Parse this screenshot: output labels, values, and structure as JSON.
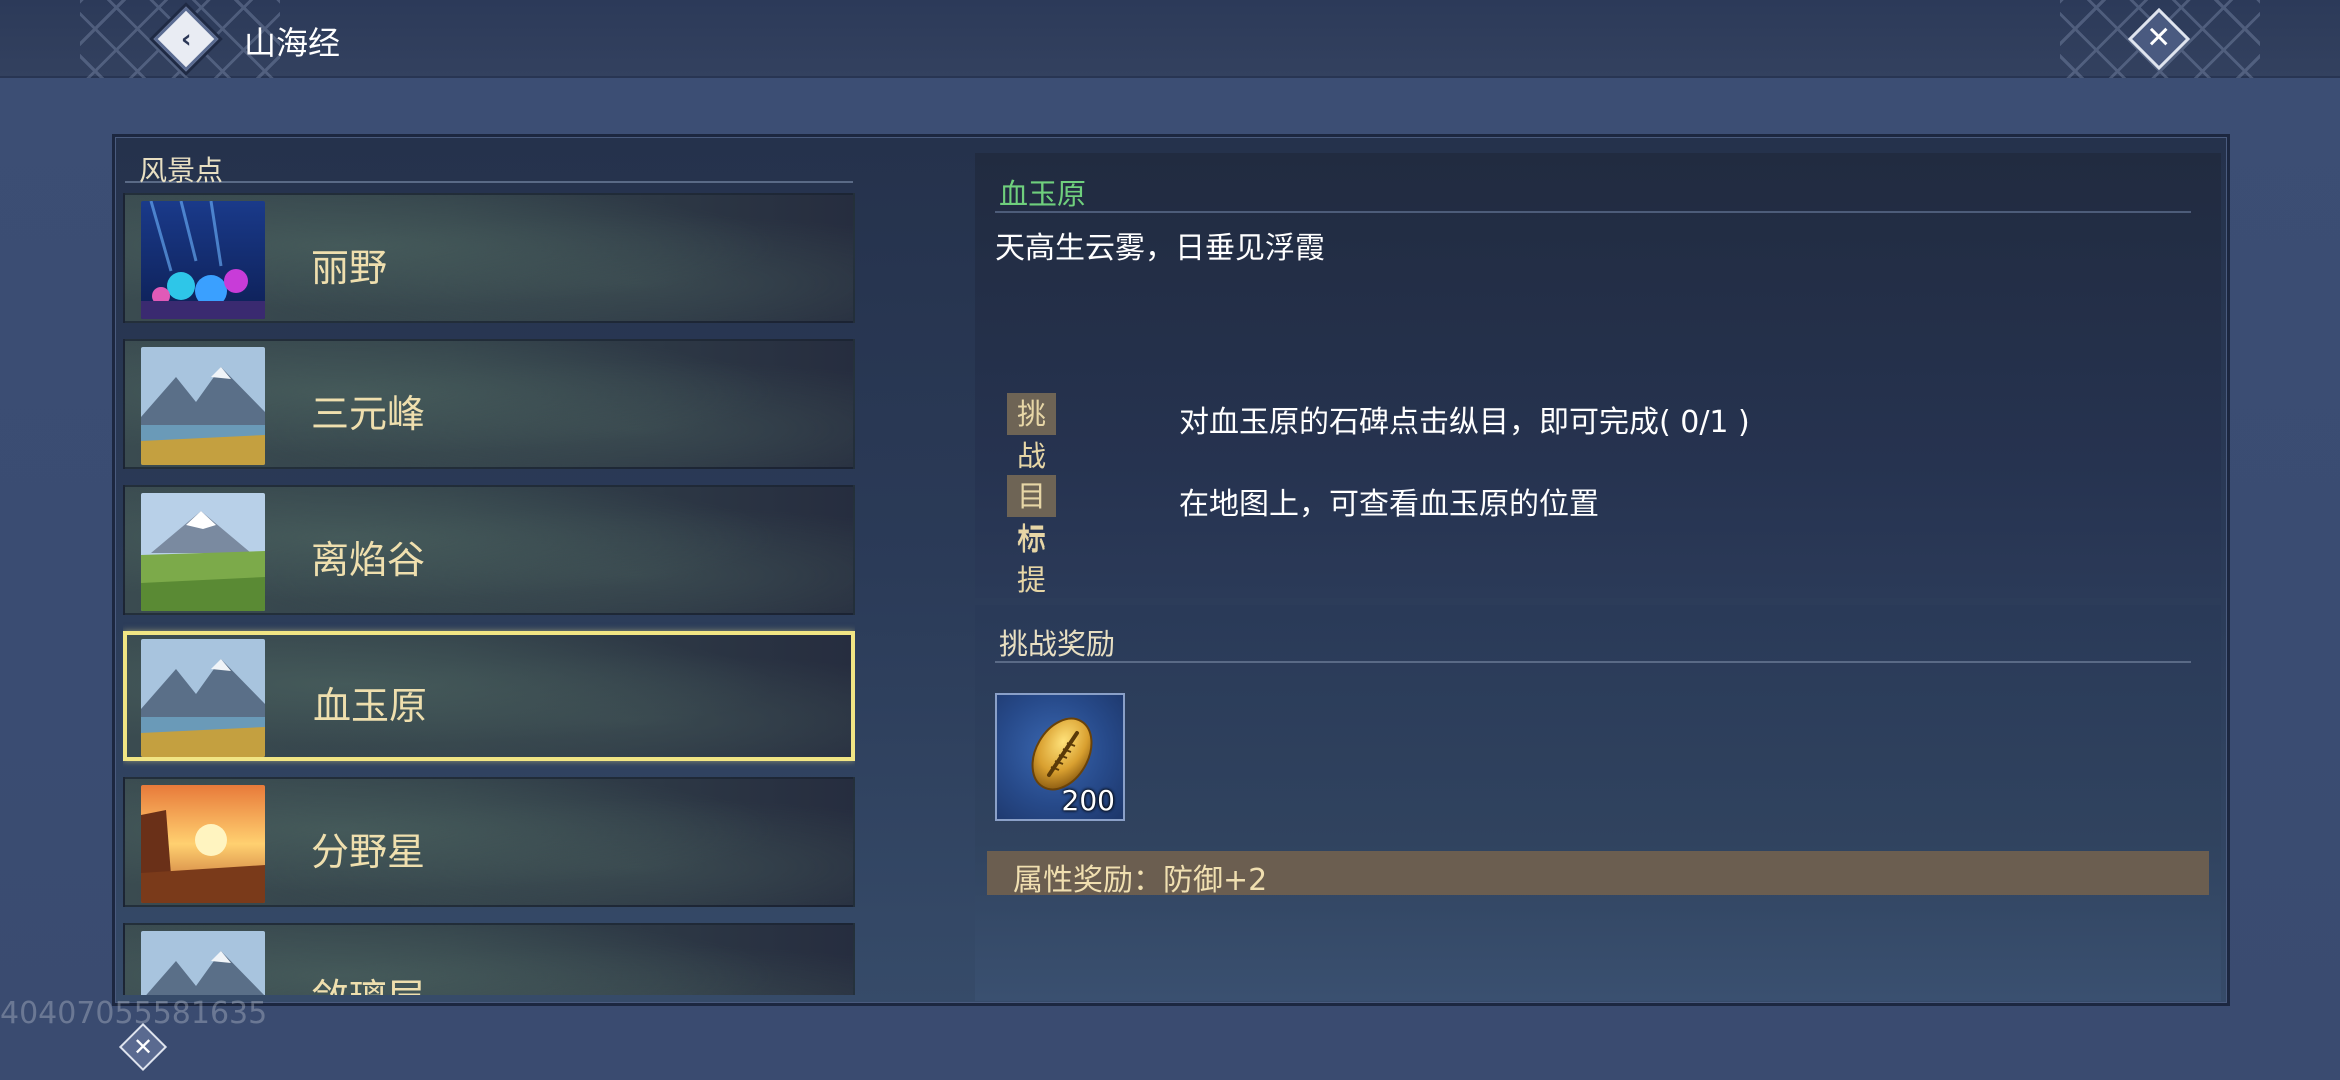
{
  "header": {
    "title": "山海经"
  },
  "list": {
    "header": "风景点",
    "items": [
      {
        "name": "丽野",
        "thumb": "underwater"
      },
      {
        "name": "三元峰",
        "thumb": "mountain-lake"
      },
      {
        "name": "离焰谷",
        "thumb": "snow-peak-meadow"
      },
      {
        "name": "血玉原",
        "thumb": "mountain-lake",
        "selected": true
      },
      {
        "name": "分野星",
        "thumb": "sunset-rock"
      },
      {
        "name": "敛璃层",
        "thumb": "mountain-lake"
      }
    ]
  },
  "detail": {
    "title": "血玉原",
    "description": "天高生云雾，日垂见浮霞",
    "tasks": [
      {
        "tag": "挑战目标",
        "text": "对血玉原的石碑点击纵目，即可完成( 0/1 )"
      },
      {
        "tag": "目标提示",
        "text": "在地图上，可查看血玉原的位置"
      }
    ]
  },
  "reward": {
    "title": "挑战奖励",
    "item": {
      "icon": "shell-coin-icon",
      "count": "200"
    },
    "attribute": "属性奖励：防御+2"
  },
  "watermark": "404070555816​35",
  "colors": {
    "selected_border": "#f1e584",
    "location_title": "#6fcf7d",
    "tag_bg": "#6e6455"
  }
}
